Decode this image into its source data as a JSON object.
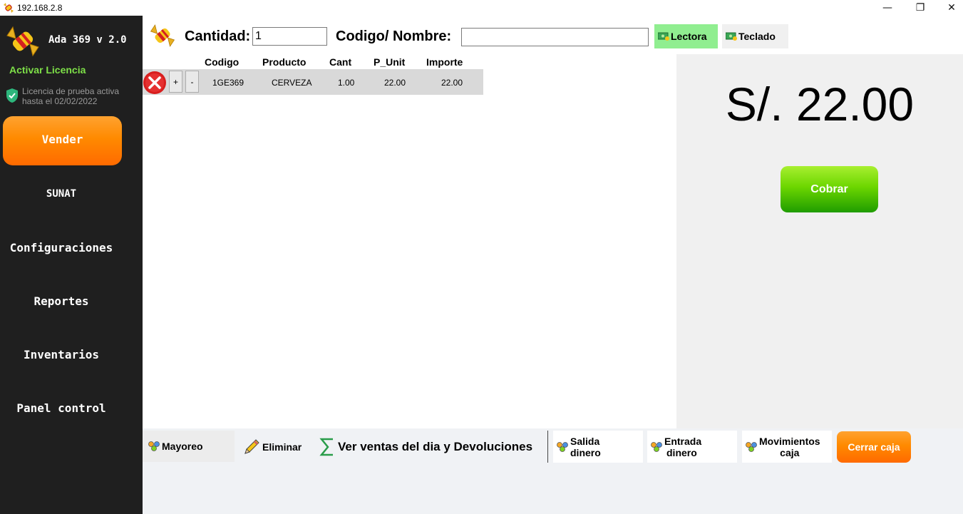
{
  "window": {
    "title": "192.168.2.8",
    "minimize_glyph": "—",
    "maximize_glyph": "❐",
    "close_glyph": "✕"
  },
  "sidebar": {
    "app_name": "Ada 369 v 2.0",
    "activate_license": "Activar Licencia",
    "license_status": "Licencia de prueba activa hasta el 02/02/2022",
    "items": [
      {
        "label": "Vender"
      },
      {
        "label": "SUNAT"
      },
      {
        "label": "Configuraciones"
      },
      {
        "label": "Reportes"
      },
      {
        "label": "Inventarios"
      },
      {
        "label": "Panel control"
      }
    ]
  },
  "toolbar": {
    "cantidad_label": "Cantidad:",
    "cantidad_value": "1",
    "codigo_label": "Codigo/ Nombre:",
    "codigo_value": "",
    "lectora_label": "Lectora",
    "teclado_label": "Teclado",
    "active_mode": "Lectora",
    "active_color": "#90ee90"
  },
  "table": {
    "headers": [
      "Codigo",
      "Producto",
      "Cant",
      "P_Unit",
      "Importe"
    ],
    "rows": [
      {
        "codigo": "1GE369",
        "producto": "CERVEZA",
        "cant": "1.00",
        "p_unit": "22.00",
        "importe": "22.00"
      }
    ],
    "plus_label": "+",
    "minus_label": "-"
  },
  "summary": {
    "total": "S/. 22.00",
    "cobrar_label": "Cobrar"
  },
  "bottom": {
    "mayoreo": "Mayoreo",
    "eliminar": "Eliminar",
    "ventas": "Ver ventas del dia y Devoluciones",
    "salida_1": "Salida",
    "salida_2": "dinero",
    "entrada_1": "Entrada",
    "entrada_2": "dinero",
    "movs_1": "Movimientos",
    "movs_2": "caja",
    "cerrar": "Cerrar caja"
  },
  "colors": {
    "sidebar_bg": "#1f1f1f",
    "accent_orange": "#ff8a00",
    "accent_green": "#6cd600",
    "license_green": "#7ee048"
  },
  "icons": {
    "app": "candy-icon",
    "license": "shield-check-icon",
    "delete": "red-x-circle-icon",
    "mode": "cash-icon",
    "group": "group-icon",
    "edit": "pencil-icon",
    "sum": "sigma-icon"
  }
}
